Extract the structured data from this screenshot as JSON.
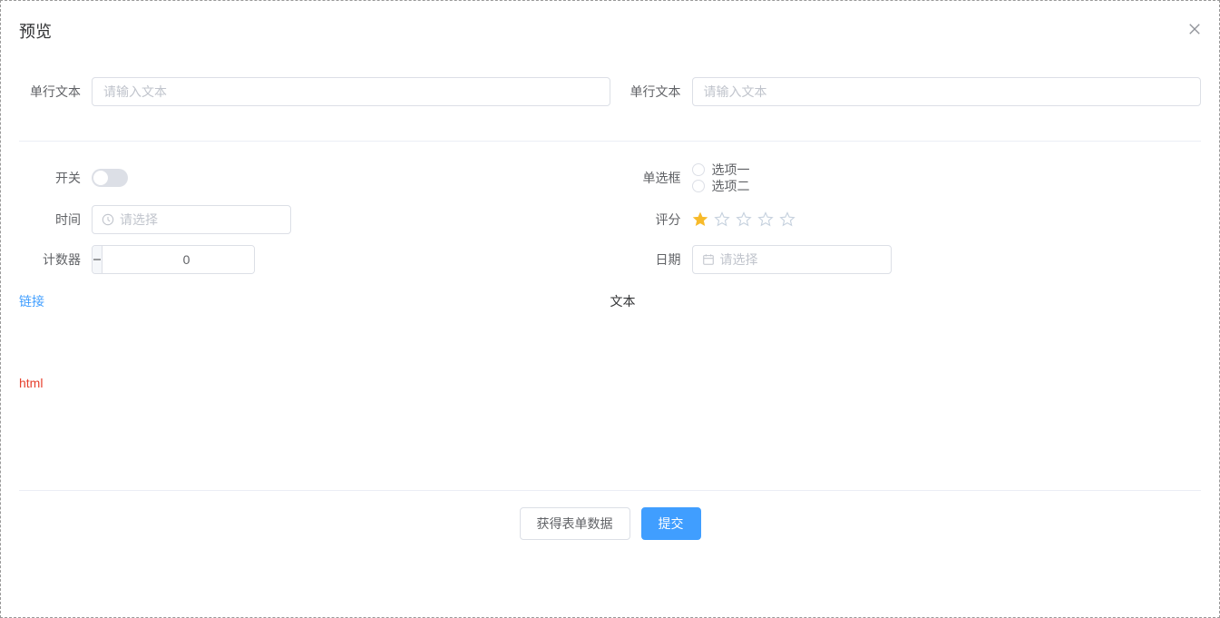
{
  "dialog": {
    "title": "预览"
  },
  "row1": {
    "left": {
      "label": "单行文本",
      "placeholder": "请输入文本"
    },
    "right": {
      "label": "单行文本",
      "placeholder": "请输入文本"
    }
  },
  "switch": {
    "label": "开关",
    "on": false
  },
  "radio": {
    "label": "单选框",
    "options": [
      "选项一",
      "选项二"
    ]
  },
  "time": {
    "label": "时间",
    "placeholder": "请选择"
  },
  "rate": {
    "label": "评分",
    "value": 1
  },
  "counter": {
    "label": "计数器",
    "value": "0"
  },
  "date": {
    "label": "日期",
    "placeholder": "请选择"
  },
  "misc": {
    "link": "链接",
    "text": "文本",
    "html": "html"
  },
  "footer": {
    "getData": "获得表单数据",
    "submit": "提交"
  }
}
